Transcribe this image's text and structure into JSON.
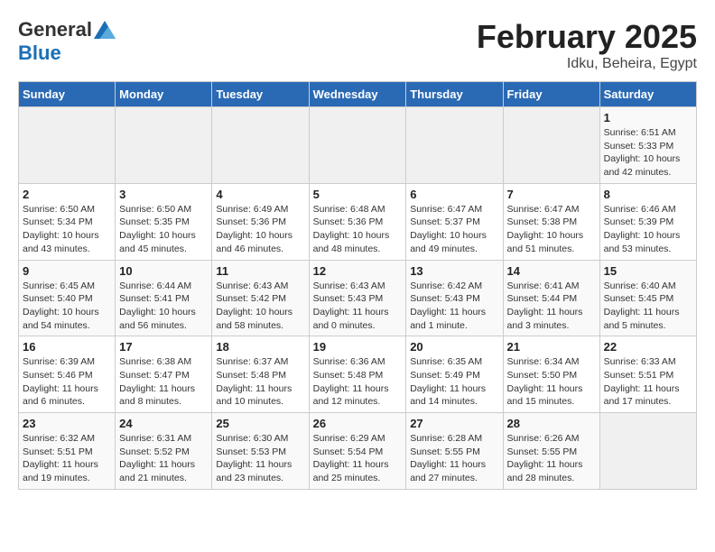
{
  "header": {
    "logo_general": "General",
    "logo_blue": "Blue",
    "month_year": "February 2025",
    "location": "Idku, Beheira, Egypt"
  },
  "weekdays": [
    "Sunday",
    "Monday",
    "Tuesday",
    "Wednesday",
    "Thursday",
    "Friday",
    "Saturday"
  ],
  "weeks": [
    [
      {
        "day": "",
        "info": ""
      },
      {
        "day": "",
        "info": ""
      },
      {
        "day": "",
        "info": ""
      },
      {
        "day": "",
        "info": ""
      },
      {
        "day": "",
        "info": ""
      },
      {
        "day": "",
        "info": ""
      },
      {
        "day": "1",
        "info": "Sunrise: 6:51 AM\nSunset: 5:33 PM\nDaylight: 10 hours and 42 minutes."
      }
    ],
    [
      {
        "day": "2",
        "info": "Sunrise: 6:50 AM\nSunset: 5:34 PM\nDaylight: 10 hours and 43 minutes."
      },
      {
        "day": "3",
        "info": "Sunrise: 6:50 AM\nSunset: 5:35 PM\nDaylight: 10 hours and 45 minutes."
      },
      {
        "day": "4",
        "info": "Sunrise: 6:49 AM\nSunset: 5:36 PM\nDaylight: 10 hours and 46 minutes."
      },
      {
        "day": "5",
        "info": "Sunrise: 6:48 AM\nSunset: 5:36 PM\nDaylight: 10 hours and 48 minutes."
      },
      {
        "day": "6",
        "info": "Sunrise: 6:47 AM\nSunset: 5:37 PM\nDaylight: 10 hours and 49 minutes."
      },
      {
        "day": "7",
        "info": "Sunrise: 6:47 AM\nSunset: 5:38 PM\nDaylight: 10 hours and 51 minutes."
      },
      {
        "day": "8",
        "info": "Sunrise: 6:46 AM\nSunset: 5:39 PM\nDaylight: 10 hours and 53 minutes."
      }
    ],
    [
      {
        "day": "9",
        "info": "Sunrise: 6:45 AM\nSunset: 5:40 PM\nDaylight: 10 hours and 54 minutes."
      },
      {
        "day": "10",
        "info": "Sunrise: 6:44 AM\nSunset: 5:41 PM\nDaylight: 10 hours and 56 minutes."
      },
      {
        "day": "11",
        "info": "Sunrise: 6:43 AM\nSunset: 5:42 PM\nDaylight: 10 hours and 58 minutes."
      },
      {
        "day": "12",
        "info": "Sunrise: 6:43 AM\nSunset: 5:43 PM\nDaylight: 11 hours and 0 minutes."
      },
      {
        "day": "13",
        "info": "Sunrise: 6:42 AM\nSunset: 5:43 PM\nDaylight: 11 hours and 1 minute."
      },
      {
        "day": "14",
        "info": "Sunrise: 6:41 AM\nSunset: 5:44 PM\nDaylight: 11 hours and 3 minutes."
      },
      {
        "day": "15",
        "info": "Sunrise: 6:40 AM\nSunset: 5:45 PM\nDaylight: 11 hours and 5 minutes."
      }
    ],
    [
      {
        "day": "16",
        "info": "Sunrise: 6:39 AM\nSunset: 5:46 PM\nDaylight: 11 hours and 6 minutes."
      },
      {
        "day": "17",
        "info": "Sunrise: 6:38 AM\nSunset: 5:47 PM\nDaylight: 11 hours and 8 minutes."
      },
      {
        "day": "18",
        "info": "Sunrise: 6:37 AM\nSunset: 5:48 PM\nDaylight: 11 hours and 10 minutes."
      },
      {
        "day": "19",
        "info": "Sunrise: 6:36 AM\nSunset: 5:48 PM\nDaylight: 11 hours and 12 minutes."
      },
      {
        "day": "20",
        "info": "Sunrise: 6:35 AM\nSunset: 5:49 PM\nDaylight: 11 hours and 14 minutes."
      },
      {
        "day": "21",
        "info": "Sunrise: 6:34 AM\nSunset: 5:50 PM\nDaylight: 11 hours and 15 minutes."
      },
      {
        "day": "22",
        "info": "Sunrise: 6:33 AM\nSunset: 5:51 PM\nDaylight: 11 hours and 17 minutes."
      }
    ],
    [
      {
        "day": "23",
        "info": "Sunrise: 6:32 AM\nSunset: 5:51 PM\nDaylight: 11 hours and 19 minutes."
      },
      {
        "day": "24",
        "info": "Sunrise: 6:31 AM\nSunset: 5:52 PM\nDaylight: 11 hours and 21 minutes."
      },
      {
        "day": "25",
        "info": "Sunrise: 6:30 AM\nSunset: 5:53 PM\nDaylight: 11 hours and 23 minutes."
      },
      {
        "day": "26",
        "info": "Sunrise: 6:29 AM\nSunset: 5:54 PM\nDaylight: 11 hours and 25 minutes."
      },
      {
        "day": "27",
        "info": "Sunrise: 6:28 AM\nSunset: 5:55 PM\nDaylight: 11 hours and 27 minutes."
      },
      {
        "day": "28",
        "info": "Sunrise: 6:26 AM\nSunset: 5:55 PM\nDaylight: 11 hours and 28 minutes."
      },
      {
        "day": "",
        "info": ""
      }
    ]
  ]
}
